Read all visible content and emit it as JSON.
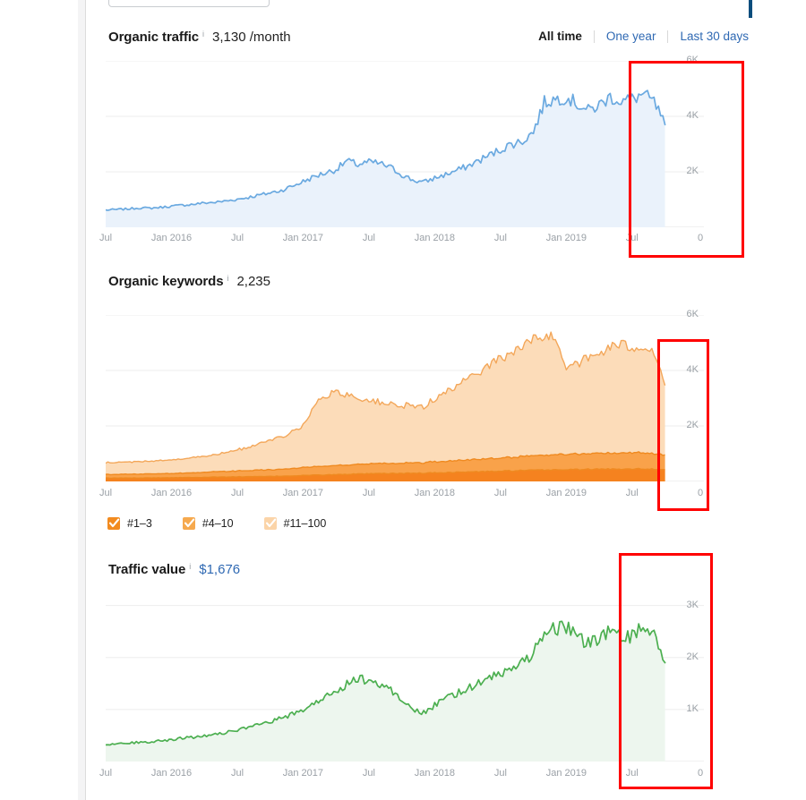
{
  "window": {
    "scroll_thumb_color": "#0a4d7d",
    "panel_bg": "#ffffff"
  },
  "range_filter": {
    "options": [
      {
        "label": "All time",
        "active": true
      },
      {
        "label": "One year",
        "active": false
      },
      {
        "label": "Last 30 days",
        "active": false
      }
    ]
  },
  "metrics": [
    {
      "id": "organic-traffic",
      "title": "Organic traffic",
      "info": "i",
      "value": "3,130 /month",
      "value_color": "#222222"
    },
    {
      "id": "organic-keywords",
      "title": "Organic keywords",
      "info": "i",
      "value": "2,235",
      "value_color": "#222222"
    },
    {
      "id": "traffic-value",
      "title": "Traffic value",
      "info": "i",
      "value": "$1,676",
      "value_color": "#2f69b3"
    }
  ],
  "legend": {
    "items": [
      {
        "label": "#1–3",
        "color": "#f28b20",
        "checked": true
      },
      {
        "label": "#4–10",
        "color": "#f6a94e",
        "checked": true
      },
      {
        "label": "#11–100",
        "color": "#fbd4a8",
        "checked": true
      }
    ]
  },
  "annotations": [
    {
      "name": "highlight-box-traffic",
      "color": "#ff0000"
    },
    {
      "name": "highlight-box-keywords",
      "color": "#ff0000"
    },
    {
      "name": "highlight-box-traffic-value",
      "color": "#ff0000"
    }
  ],
  "chart_data": [
    {
      "id": "organic-traffic",
      "type": "area",
      "title": "Organic traffic",
      "xlabel": "",
      "ylabel": "",
      "line_color": "#6aa9e0",
      "fill_color": "#eaf2fb",
      "grid": true,
      "legend_position": "none",
      "ylim": [
        0,
        6000
      ],
      "yticks": [
        0,
        2000,
        4000,
        6000
      ],
      "ytick_labels": [
        "0",
        "2K",
        "4K",
        "6K"
      ],
      "xticks": [
        "Jul",
        "Jan 2016",
        "Jul",
        "Jan 2017",
        "Jul",
        "Jan 2018",
        "Jul",
        "Jan 2019",
        "Jul"
      ],
      "x": [
        "2015-07",
        "2015-08",
        "2015-09",
        "2015-10",
        "2015-11",
        "2015-12",
        "2016-01",
        "2016-02",
        "2016-03",
        "2016-04",
        "2016-05",
        "2016-06",
        "2016-07",
        "2016-08",
        "2016-09",
        "2016-10",
        "2016-11",
        "2016-12",
        "2017-01",
        "2017-02",
        "2017-03",
        "2017-04",
        "2017-05",
        "2017-06",
        "2017-07",
        "2017-08",
        "2017-09",
        "2017-10",
        "2017-11",
        "2017-12",
        "2018-01",
        "2018-02",
        "2018-03",
        "2018-04",
        "2018-05",
        "2018-06",
        "2018-07",
        "2018-08",
        "2018-09",
        "2018-10",
        "2018-11",
        "2018-12",
        "2019-01",
        "2019-02",
        "2019-03",
        "2019-04",
        "2019-05",
        "2019-06",
        "2019-07",
        "2019-08",
        "2019-09",
        "2019-10"
      ],
      "values": [
        620,
        640,
        660,
        700,
        690,
        720,
        760,
        800,
        830,
        880,
        900,
        950,
        1010,
        1080,
        1160,
        1240,
        1330,
        1480,
        1650,
        1820,
        1960,
        2080,
        2400,
        2260,
        2350,
        2300,
        2150,
        1900,
        1700,
        1620,
        1780,
        1900,
        2050,
        2200,
        2400,
        2600,
        2800,
        3000,
        3100,
        3450,
        4500,
        4620,
        4700,
        4450,
        4200,
        4400,
        4700,
        4550,
        4620,
        4800,
        4500,
        3700
      ],
      "annotation": {
        "label": "highlight-box",
        "x_start": "2019-06",
        "x_end": "2019-10",
        "color": "#ff0000"
      }
    },
    {
      "id": "organic-keywords",
      "type": "area",
      "stacked": true,
      "title": "Organic keywords",
      "xlabel": "",
      "ylabel": "",
      "grid": true,
      "legend_position": "bottom",
      "ylim": [
        0,
        6000
      ],
      "yticks": [
        0,
        2000,
        4000,
        6000
      ],
      "ytick_labels": [
        "0",
        "2K",
        "4K",
        "6K"
      ],
      "xticks": [
        "Jul",
        "Jan 2016",
        "Jul",
        "Jan 2017",
        "Jul",
        "Jan 2018",
        "Jul",
        "Jan 2019",
        "Jul"
      ],
      "x": [
        "2015-07",
        "2015-08",
        "2015-09",
        "2015-10",
        "2015-11",
        "2015-12",
        "2016-01",
        "2016-02",
        "2016-03",
        "2016-04",
        "2016-05",
        "2016-06",
        "2016-07",
        "2016-08",
        "2016-09",
        "2016-10",
        "2016-11",
        "2016-12",
        "2017-01",
        "2017-02",
        "2017-03",
        "2017-04",
        "2017-05",
        "2017-06",
        "2017-07",
        "2017-08",
        "2017-09",
        "2017-10",
        "2017-11",
        "2017-12",
        "2018-01",
        "2018-02",
        "2018-03",
        "2018-04",
        "2018-05",
        "2018-06",
        "2018-07",
        "2018-08",
        "2018-09",
        "2018-10",
        "2018-11",
        "2018-12",
        "2019-01",
        "2019-02",
        "2019-03",
        "2019-04",
        "2019-05",
        "2019-06",
        "2019-07",
        "2019-08",
        "2019-09",
        "2019-10"
      ],
      "series": [
        {
          "name": "#1–3",
          "color": "#f5821f",
          "values": [
            120,
            120,
            125,
            125,
            130,
            130,
            135,
            140,
            145,
            150,
            155,
            160,
            165,
            170,
            175,
            180,
            190,
            200,
            215,
            225,
            235,
            245,
            255,
            265,
            275,
            280,
            285,
            290,
            295,
            300,
            310,
            320,
            330,
            340,
            350,
            360,
            370,
            380,
            390,
            400,
            410,
            420,
            425,
            430,
            435,
            440,
            445,
            450,
            455,
            450,
            445,
            430
          ]
        },
        {
          "name": "#4–10",
          "color": "#f9a24a",
          "values": [
            130,
            130,
            135,
            140,
            145,
            150,
            155,
            160,
            170,
            180,
            190,
            200,
            210,
            220,
            230,
            240,
            250,
            265,
            280,
            295,
            310,
            325,
            335,
            345,
            355,
            360,
            365,
            370,
            375,
            380,
            390,
            400,
            415,
            430,
            445,
            460,
            475,
            490,
            500,
            515,
            530,
            545,
            555,
            560,
            565,
            570,
            575,
            580,
            585,
            575,
            560,
            530
          ]
        },
        {
          "name": "#11–100",
          "color": "#fcdcb9",
          "values": [
            420,
            430,
            440,
            450,
            460,
            475,
            490,
            510,
            540,
            580,
            620,
            680,
            760,
            840,
            930,
            1040,
            1160,
            1320,
            1520,
            2180,
            2550,
            2600,
            2580,
            2400,
            2280,
            2200,
            2120,
            2060,
            2020,
            2050,
            2250,
            2480,
            2680,
            2900,
            3180,
            3420,
            3600,
            3760,
            3950,
            4180,
            4300,
            4180,
            3200,
            3320,
            3420,
            3560,
            3860,
            3880,
            3800,
            3860,
            3700,
            2500
          ]
        }
      ],
      "annotation": {
        "label": "highlight-box",
        "x_start": "2019-07",
        "x_end": "2019-09",
        "color": "#ff0000"
      }
    },
    {
      "id": "traffic-value",
      "type": "area",
      "title": "Traffic value",
      "xlabel": "",
      "ylabel": "",
      "line_color": "#4caf50",
      "fill_color": "#edf6ee",
      "grid": true,
      "legend_position": "none",
      "ylim": [
        0,
        3200
      ],
      "yticks": [
        0,
        1000,
        2000,
        3000
      ],
      "ytick_labels": [
        "0",
        "1K",
        "2K",
        "3K"
      ],
      "xticks": [
        "Jul",
        "Jan 2016",
        "Jul",
        "Jan 2017",
        "Jul",
        "Jan 2018",
        "Jul",
        "Jan 2019",
        "Jul"
      ],
      "x": [
        "2015-07",
        "2015-08",
        "2015-09",
        "2015-10",
        "2015-11",
        "2015-12",
        "2016-01",
        "2016-02",
        "2016-03",
        "2016-04",
        "2016-05",
        "2016-06",
        "2016-07",
        "2016-08",
        "2016-09",
        "2016-10",
        "2016-11",
        "2016-12",
        "2017-01",
        "2017-02",
        "2017-03",
        "2017-04",
        "2017-05",
        "2017-06",
        "2017-07",
        "2017-08",
        "2017-09",
        "2017-10",
        "2017-11",
        "2017-12",
        "2018-01",
        "2018-02",
        "2018-03",
        "2018-04",
        "2018-05",
        "2018-06",
        "2018-07",
        "2018-08",
        "2018-09",
        "2018-10",
        "2018-11",
        "2018-12",
        "2019-01",
        "2019-02",
        "2019-03",
        "2019-04",
        "2019-05",
        "2019-06",
        "2019-07",
        "2019-08",
        "2019-09",
        "2019-10"
      ],
      "values": [
        330,
        340,
        355,
        370,
        380,
        400,
        420,
        450,
        470,
        500,
        530,
        560,
        600,
        650,
        700,
        760,
        830,
        900,
        1000,
        1120,
        1240,
        1350,
        1500,
        1600,
        1560,
        1480,
        1380,
        1200,
        1000,
        940,
        1080,
        1200,
        1300,
        1420,
        1500,
        1600,
        1680,
        1800,
        1900,
        2100,
        2480,
        2560,
        2600,
        2400,
        2260,
        2380,
        2500,
        2380,
        2400,
        2600,
        2450,
        1900
      ],
      "annotation": {
        "label": "highlight-box",
        "x_start": "2019-05",
        "x_end": "2019-10",
        "color": "#ff0000"
      }
    }
  ]
}
